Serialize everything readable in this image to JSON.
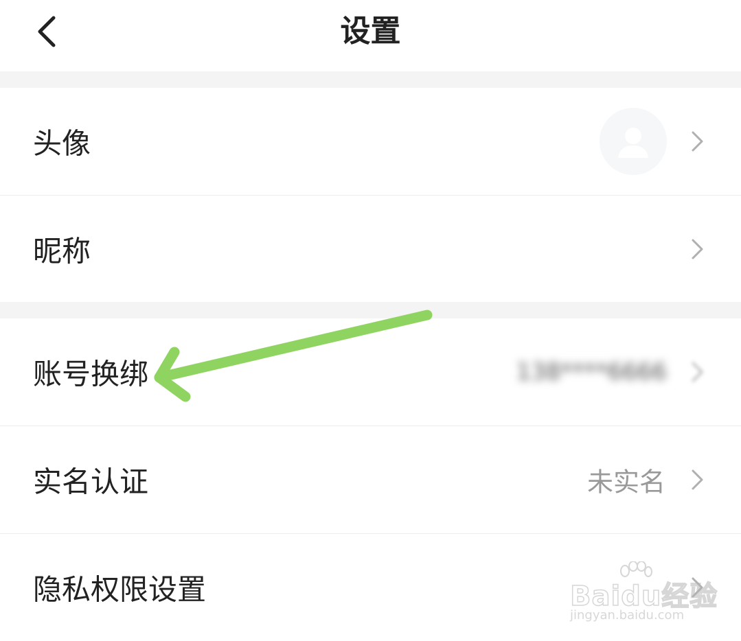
{
  "header": {
    "title": "设置",
    "back_icon": "chevron-left-icon"
  },
  "settings": {
    "avatar": {
      "label": "头像"
    },
    "nickname": {
      "label": "昵称"
    },
    "account_rebind": {
      "label": "账号换绑",
      "value": "138****6666"
    },
    "real_name": {
      "label": "实名认证",
      "value": "未实名"
    },
    "privacy": {
      "label": "隐私权限设置"
    }
  },
  "annotation": {
    "arrow_color": "#8fd460",
    "icon": "arrow-pointer-icon"
  },
  "watermark": {
    "brand": "Baidu经验",
    "url": "jingyan.baidu.com"
  },
  "colors": {
    "background": "#ffffff",
    "section_gap": "#f4f4f4",
    "text_primary": "#222222",
    "text_secondary": "#999999",
    "chevron": "#b0b0b0"
  }
}
